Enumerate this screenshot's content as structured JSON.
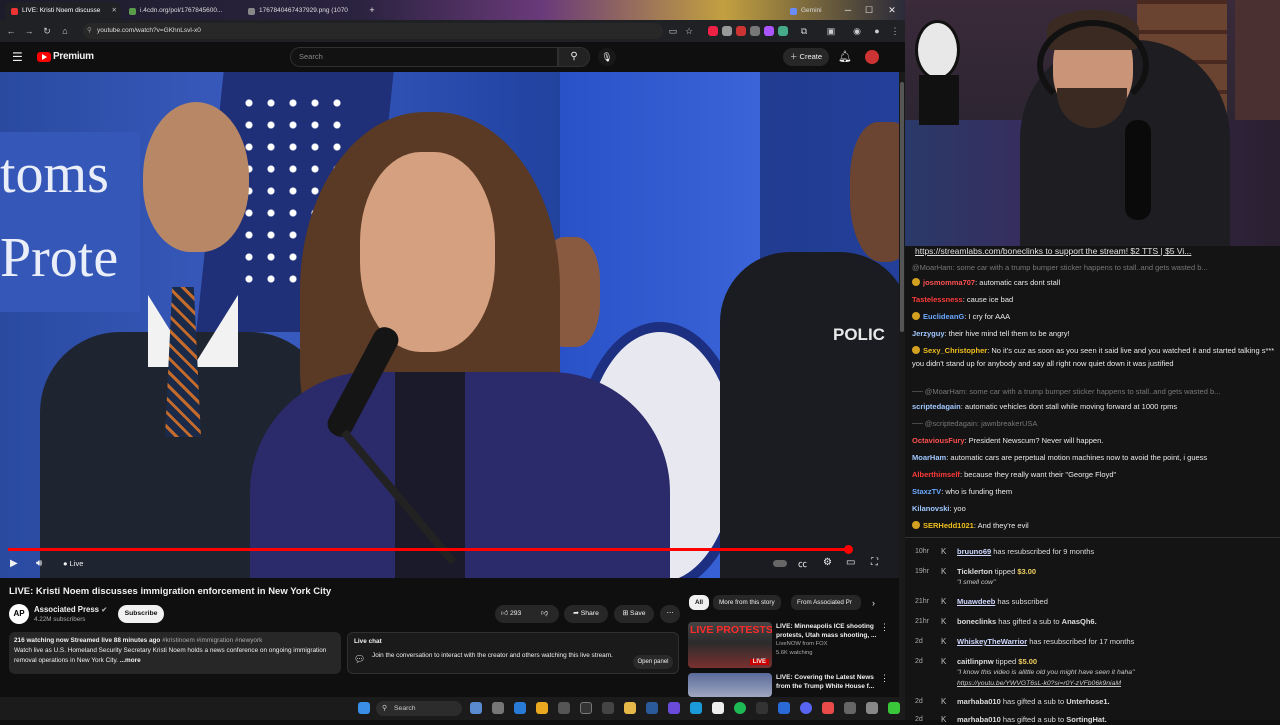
{
  "browser": {
    "tabs": [
      {
        "label": "LIVE: Kristi Noem discusse",
        "active": true
      },
      {
        "label": "i.4cdn.org/pol/1767845600...",
        "active": false
      },
      {
        "label": "1767840467437929.png (1070",
        "active": false
      }
    ],
    "right_tab": "Gemini",
    "url": "youtube.com/watch?v=GKhnLsvl-x0"
  },
  "youtube": {
    "logo": "Premium",
    "search_placeholder": "Search",
    "create_label": "Create",
    "player": {
      "live_label": "Live",
      "progress": 0.94
    },
    "video_title": "LIVE: Kristi Noem discusses immigration enforcement in New York City",
    "channel": {
      "logo_text": "AP",
      "name": "Associated Press",
      "subscribers": "4.22M subscribers",
      "subscribe_label": "Subscribe"
    },
    "actions": {
      "likes": "293",
      "share": "Share",
      "save": "Save"
    },
    "description": {
      "stats": "216 watching now  Streamed live 88 minutes ago",
      "hashtags": "#kristinoem #immigration #newyork",
      "text": "Watch live as U.S. Homeland Security Secretary Kristi Noem holds a news conference on ongoing immigration removal operations in New York City.",
      "more": "...more"
    },
    "live_chat": {
      "title": "Live chat",
      "text": "Join the conversation to interact with the creator and others watching this live stream.",
      "button": "Open panel"
    },
    "chips": [
      "All",
      "More from this story",
      "From Associated Pr"
    ],
    "recommendations": [
      {
        "thumb_text": "LIVE PROTESTS",
        "badge": "LIVE",
        "title": "LIVE: Minneapolis ICE shooting protests, Utah mass shooting, ...",
        "channel": "LiveNOW from FOX",
        "meta": "5.6K watching"
      },
      {
        "thumb_text": "",
        "badge": "",
        "title": "LIVE: Covering the Latest News from the Trump White House f...",
        "channel": "",
        "meta": ""
      }
    ]
  },
  "taskbar": {
    "search_label": "Search"
  },
  "chat": {
    "pinned": "https://streamlabs.com/boneclinks to support the stream! $2 TTS | $5 Vi...",
    "top_faded": "@MoarHam: some car with a trump bumper sticker happens to stall..and gets wasted b...",
    "messages": [
      {
        "user": "josmomma707",
        "color": "#ff5050",
        "text": "automatic cars dont stall",
        "badge": true
      },
      {
        "user": "Tastelessness",
        "color": "#ff3a3a",
        "text": "cause ice bad",
        "badge": false
      },
      {
        "user": "EuclideanG",
        "color": "#6aa8ff",
        "text": "I cry for AAA",
        "badge": true
      },
      {
        "user": "Jerzyguy",
        "color": "#a0c8ff",
        "text": "their hive mind tell them to be angry!",
        "badge": false
      },
      {
        "user": "Sexy_Christopher",
        "color": "#f0c020",
        "text": "No it's cuz as soon as you seen it said live and you watched it and started talking s*** you didn't stand up for anybody and say all right now quiet down it was justified",
        "badge": true
      },
      {
        "reply": "@MoarHam: some car with a trump bumper sticker happens to stall..and gets wasted b..."
      },
      {
        "user": "scriptedagain",
        "color": "#a0c8ff",
        "text": "automatic vehicles dont stall while moving forward at 1000 rpms",
        "badge": false
      },
      {
        "reply": "@scriptedagain: jawnbreakerUSA"
      },
      {
        "user": "OctaviousFury",
        "color": "#ff5050",
        "text": "President Newscum? Never will happen.",
        "badge": false
      },
      {
        "user": "MoarHam",
        "color": "#a0c8ff",
        "text": "automatic cars are perpetual motion machines now to avoid the point, i guess",
        "badge": false
      },
      {
        "user": "Alberthimself",
        "color": "#ff3a3a",
        "text": "because they really want their \"George Floyd\"",
        "badge": false
      },
      {
        "user": "StaxzTV",
        "color": "#6aa8ff",
        "text": "who is funding them",
        "badge": false
      },
      {
        "user": "Kilanovski",
        "color": "#a0c8ff",
        "text": "yoo",
        "badge": false
      },
      {
        "user": "SERHedd1021",
        "color": "#f0c020",
        "text": "And they're evil",
        "badge": true
      }
    ],
    "events": [
      {
        "time": "10hr",
        "name": "bruuno69",
        "text": " has resubscribed for 9 months",
        "underline": true
      },
      {
        "time": "19hr",
        "name": "Ticklerton",
        "text": " tipped ",
        "amount": "$3.00",
        "note": "\"I smell cow\""
      },
      {
        "time": "21hr",
        "name": "Muawdeeb",
        "text": " has subscribed",
        "underline": true
      },
      {
        "time": "21hr",
        "name": "boneclinks",
        "text": " has gifted a sub to ",
        "target": "AnasQh6."
      },
      {
        "time": "2d",
        "name": "WhiskeyTheWarrior",
        "text": " has resubscribed for 17 months",
        "underline": true
      },
      {
        "time": "2d",
        "name": "caitlinpnw",
        "text": " tipped ",
        "amount": "$5.00",
        "note": "\"I know this video is alittle old you might have seen it haha\"",
        "link": "https://youtu.be/YWVGT6sL-k0?si=r0Y-zVFb06k9niaM"
      },
      {
        "time": "2d",
        "name": "marhaba010",
        "text": " has gifted a sub to ",
        "target": "Unterhose1."
      },
      {
        "time": "2d",
        "name": "marhaba010",
        "text": " has gifted a sub to ",
        "target": "SortingHat."
      }
    ]
  }
}
